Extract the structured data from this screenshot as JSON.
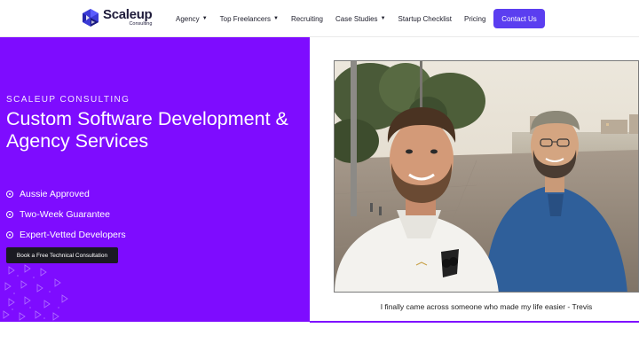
{
  "brand": {
    "name": "Scaleup",
    "sub": "Consulting"
  },
  "nav": {
    "items": [
      {
        "label": "Agency",
        "caret": true
      },
      {
        "label": "Top Freelancers",
        "caret": true
      },
      {
        "label": "Recruiting",
        "caret": false
      },
      {
        "label": "Case Studies",
        "caret": true
      },
      {
        "label": "Startup Checklist",
        "caret": false
      },
      {
        "label": "Pricing",
        "caret": false
      }
    ],
    "contact_label": "Contact Us"
  },
  "hero": {
    "eyebrow": "SCALEUP CONSULTING",
    "headline": "Custom Software Development & Agency Services",
    "bullets": [
      "Aussie Approved",
      "Two-Week Guarantee",
      "Expert-Vetted Developers"
    ],
    "cta_label": "Book a Free Technical Consultation"
  },
  "testimonial": {
    "caption": "I finally came across someone who made my life easier - Trevis"
  },
  "colors": {
    "accent": "#7e0cff",
    "button": "#5b3ef0",
    "dark": "#1a1a22"
  }
}
